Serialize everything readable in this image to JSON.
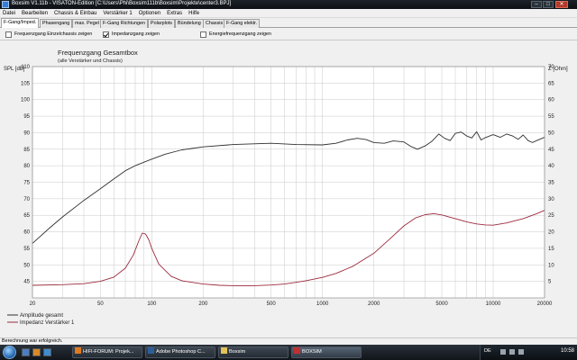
{
  "window": {
    "title": "Boxsim V1.11b - VISATON-Edition [C:\\Users\\Phi\\Boxsim111b\\Boxsim\\Projekte\\center3.BPJ]",
    "minimize_glyph": "–",
    "maximize_glyph": "□",
    "close_glyph": "✕"
  },
  "menu": [
    "Datei",
    "Bearbeiten",
    "Chassis & Einbau",
    "Verstärker 1",
    "Optionen",
    "Extras",
    "Hilfe"
  ],
  "tabs": [
    {
      "label": "F-Gang/Imped.",
      "active": true
    },
    {
      "label": "Phasengang",
      "active": false
    },
    {
      "label": "max. Pegel",
      "active": false
    },
    {
      "label": "F-Gang Richtungen",
      "active": false
    },
    {
      "label": "Polarplots",
      "active": false
    },
    {
      "label": "Bündelung",
      "active": false
    },
    {
      "label": "Chassis",
      "active": false
    },
    {
      "label": "F-Gang elektr.",
      "active": false
    }
  ],
  "options": [
    {
      "label": "Frequenzgang Einzelchassis zeigen",
      "checked": false
    },
    {
      "label": "Impedanzgang zeigen",
      "checked": true
    },
    {
      "label": "Energiefrequenzgang zeigen",
      "checked": false
    }
  ],
  "status": {
    "text": "Berechnung war erfolgreich."
  },
  "taskbar": {
    "buttons": [
      {
        "label": "HIFI-FORUM: Projek...",
        "icon": "firefox-icon",
        "active": false
      },
      {
        "label": "Adobe Photoshop C...",
        "icon": "photoshop-icon",
        "active": false
      },
      {
        "label": "Boxsim",
        "icon": "folder-icon",
        "active": false
      },
      {
        "label": "BOXSIM",
        "icon": "boxsim-icon",
        "active": true
      }
    ],
    "language": "DE",
    "clock": "10:58"
  },
  "colors": {
    "amplitude": "#303030",
    "impedance": "#9c2a3e",
    "grid": "#c8c8c8",
    "plot_bg": "#ffffff"
  },
  "chart_data": {
    "type": "line",
    "title": "Frequenzgang Gesamtbox",
    "subtitle": "(alle Verstärker und Chassis)",
    "x_scale": "log",
    "xlim": [
      20,
      20000
    ],
    "x_ticks": [
      20,
      50,
      100,
      200,
      500,
      1000,
      2000,
      5000,
      10000,
      20000
    ],
    "left_axis": {
      "label": "SPL [dB]",
      "range": [
        40,
        110
      ],
      "ticks": [
        45,
        50,
        55,
        60,
        65,
        70,
        75,
        80,
        85,
        90,
        95,
        100,
        105,
        110
      ]
    },
    "right_axis": {
      "label": "Z [Ohm]",
      "range": [
        0,
        70
      ],
      "ticks": [
        5,
        10,
        15,
        20,
        25,
        30,
        35,
        40,
        45,
        50,
        55,
        60,
        65,
        70
      ]
    },
    "grid": true,
    "legend_position": "bottom-left",
    "series": [
      {
        "name": "Amplitude gesamt",
        "axis": "left",
        "x": [
          20,
          25,
          30,
          40,
          50,
          60,
          70,
          80,
          100,
          120,
          150,
          200,
          300,
          500,
          700,
          1000,
          1200,
          1400,
          1600,
          1800,
          2000,
          2300,
          2600,
          3000,
          3300,
          3600,
          4000,
          4400,
          4800,
          5200,
          5600,
          6000,
          6500,
          7000,
          7500,
          8000,
          8500,
          9000,
          10000,
          11000,
          12000,
          13000,
          14000,
          15000,
          16000,
          17000,
          18000,
          20000
        ],
        "y": [
          56.5,
          61,
          64.5,
          69.5,
          73,
          76,
          78.5,
          80,
          82,
          83.5,
          84.8,
          85.7,
          86.4,
          86.8,
          86.4,
          86.3,
          86.8,
          87.8,
          88.3,
          87.9,
          87.0,
          86.8,
          87.5,
          87.2,
          85.8,
          85.0,
          86.0,
          87.5,
          89.6,
          88.3,
          87.6,
          89.8,
          90.2,
          89.0,
          88.4,
          90.3,
          87.8,
          88.5,
          89.4,
          88.6,
          89.6,
          89.0,
          88.0,
          89.3,
          87.6,
          87.0,
          87.6,
          88.6
        ]
      },
      {
        "name": "Impedanz Verstärker 1",
        "axis": "right",
        "x": [
          20,
          30,
          40,
          50,
          60,
          70,
          78,
          84,
          88,
          92,
          96,
          100,
          110,
          130,
          150,
          200,
          250,
          300,
          400,
          500,
          600,
          700,
          800,
          1000,
          1200,
          1500,
          2000,
          2500,
          3000,
          3500,
          4000,
          4500,
          5000,
          6000,
          7000,
          8000,
          9000,
          10000,
          12000,
          15000,
          18000,
          20000
        ],
        "y": [
          3.8,
          4.0,
          4.3,
          5.0,
          6.3,
          9.0,
          13.0,
          17.3,
          19.6,
          19.3,
          17.6,
          15.0,
          10.2,
          6.5,
          5.2,
          4.2,
          3.8,
          3.7,
          3.7,
          3.9,
          4.2,
          4.7,
          5.2,
          6.2,
          7.4,
          9.5,
          13.5,
          18.0,
          21.8,
          24.2,
          25.2,
          25.5,
          25.1,
          24.0,
          23.0,
          22.4,
          22.1,
          22.0,
          22.7,
          24.0,
          25.5,
          26.5
        ]
      }
    ]
  }
}
